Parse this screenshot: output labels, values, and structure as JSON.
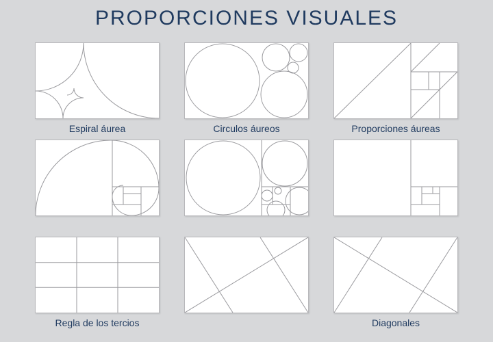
{
  "title": "PROPORCIONES VISUALES",
  "items": [
    {
      "id": "golden-spiral",
      "label": "Espiral áurea"
    },
    {
      "id": "golden-circles",
      "label": "Circulos áureos"
    },
    {
      "id": "golden-proportions",
      "label": "Proporciones áureas"
    },
    {
      "id": "golden-spiral-grid",
      "label": ""
    },
    {
      "id": "circles-spiral",
      "label": ""
    },
    {
      "id": "golden-sections",
      "label": ""
    },
    {
      "id": "rule-of-thirds",
      "label": "Regla de los tercios"
    },
    {
      "id": "diagonals-a",
      "label": ""
    },
    {
      "id": "diagonals-b",
      "label": "Diagonales"
    }
  ],
  "colors": {
    "bg": "#d7d8da",
    "panel": "#ffffff",
    "line": "#9a9a9e",
    "text": "#1f3a5f"
  }
}
